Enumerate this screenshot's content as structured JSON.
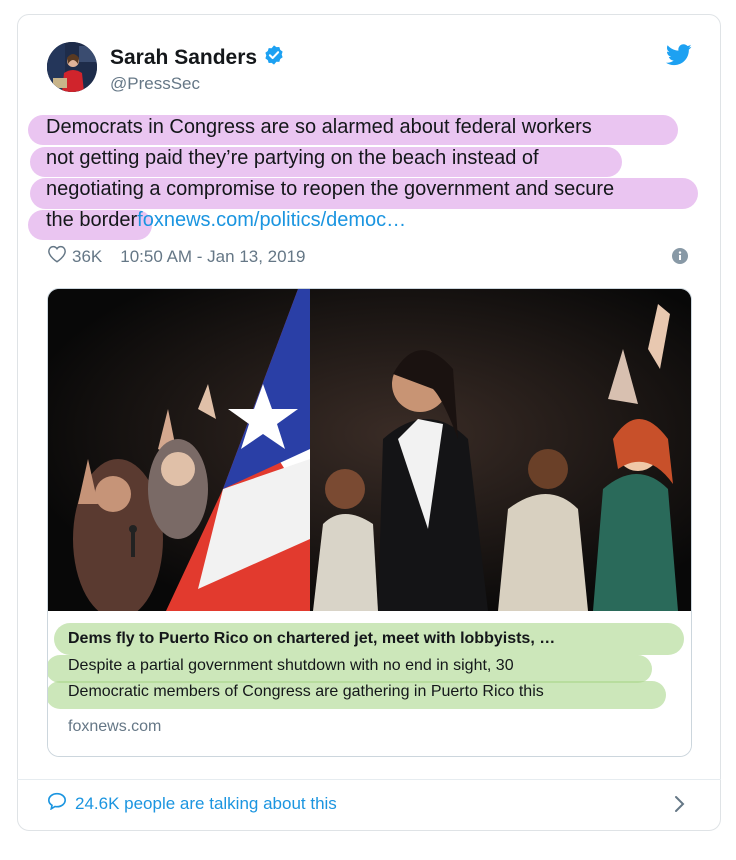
{
  "author": {
    "name": "Sarah Sanders",
    "handle": "@PressSec",
    "verified": true
  },
  "tweet": {
    "lines": [
      "Democrats in Congress are so alarmed about federal workers",
      "not getting paid they’re partying on the beach instead of",
      "negotiating a compromise to reopen the government and secure",
      "the border"
    ],
    "link_text": "foxnews.com/politics/democ…",
    "likes": "36K",
    "timestamp": "10:50 AM - Jan 13, 2019"
  },
  "link_card": {
    "title": "Dems fly to Puerto Rico on chartered jet, meet with lobbyists, …",
    "description_lines": [
      "Despite a partial government shutdown with no end in sight, 30",
      "Democratic members of Congress are gathering in Puerto Rico this"
    ],
    "domain": "foxnews.com"
  },
  "footer": {
    "conversation": "24.6K people are talking about this"
  },
  "colors": {
    "link": "#1b95e0",
    "secondary_text": "#657786",
    "highlight_purple": "#d996e6",
    "highlight_green": "#aad78c",
    "verified_blue": "#1da1f2"
  },
  "icons": [
    "verified-badge-icon",
    "twitter-bird-icon",
    "heart-icon",
    "info-icon",
    "speech-bubble-icon",
    "chevron-right-icon"
  ]
}
